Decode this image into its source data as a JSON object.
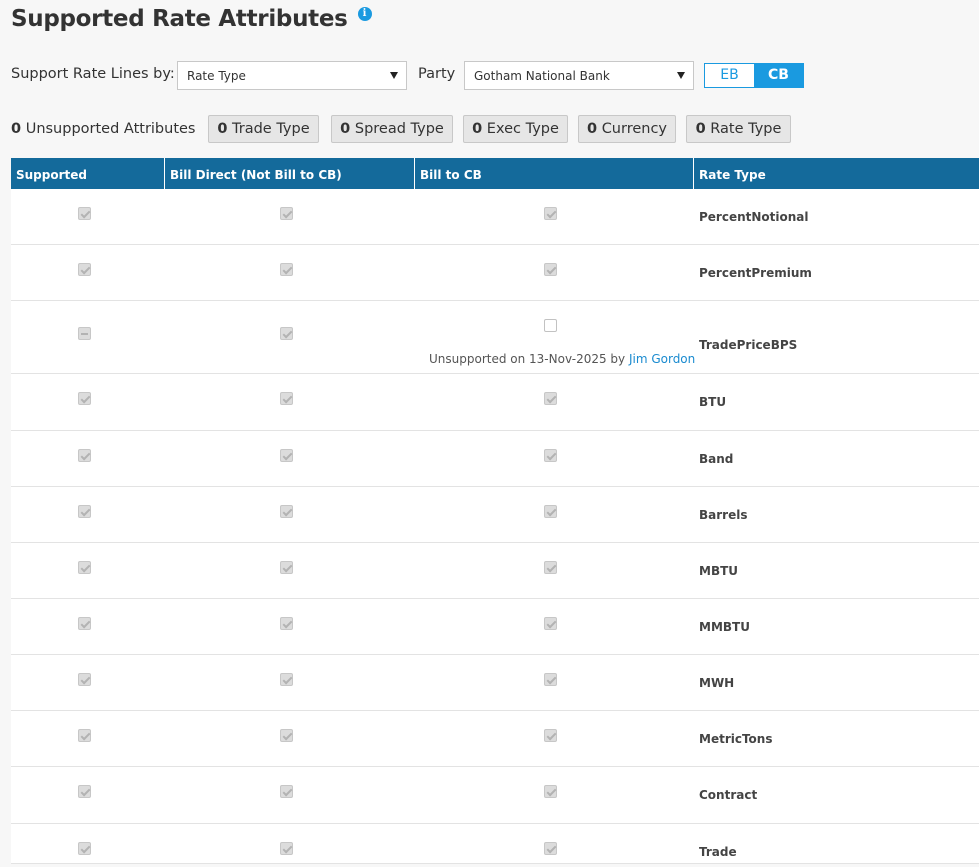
{
  "page": {
    "title": "Supported Rate Attributes",
    "info_icon": "i"
  },
  "controls": {
    "support_label": "Support Rate Lines by:",
    "support_select": "Rate Type",
    "party_label": "Party",
    "party_select": "Gotham National Bank",
    "toggle": {
      "eb": "EB",
      "cb": "CB",
      "selected": "CB"
    }
  },
  "filters": {
    "unsupported_count": "0",
    "unsupported_label": "Unsupported Attributes",
    "chips": [
      {
        "count": "0",
        "label": "Trade Type"
      },
      {
        "count": "0",
        "label": "Spread Type"
      },
      {
        "count": "0",
        "label": "Exec Type"
      },
      {
        "count": "0",
        "label": "Currency"
      },
      {
        "count": "0",
        "label": "Rate Type"
      }
    ]
  },
  "table": {
    "headers": [
      "Supported",
      "Bill Direct (Not Bill to CB)",
      "Bill to CB",
      "Rate Type"
    ],
    "rows": [
      {
        "rate_type": "PercentNotional",
        "supported": "checked",
        "bill_direct": "checked",
        "bill_to_cb": "checked"
      },
      {
        "rate_type": "PercentPremium",
        "supported": "checked",
        "bill_direct": "checked",
        "bill_to_cb": "checked"
      },
      {
        "rate_type": "TradePriceBPS",
        "supported": "indeterminate",
        "bill_direct": "checked",
        "bill_to_cb": "unchecked",
        "note_prefix": "Unsupported on 13-Nov-2025 by ",
        "note_user": "Jim Gordon"
      },
      {
        "rate_type": "BTU",
        "supported": "checked",
        "bill_direct": "checked",
        "bill_to_cb": "checked"
      },
      {
        "rate_type": "Band",
        "supported": "checked",
        "bill_direct": "checked",
        "bill_to_cb": "checked"
      },
      {
        "rate_type": "Barrels",
        "supported": "checked",
        "bill_direct": "checked",
        "bill_to_cb": "checked"
      },
      {
        "rate_type": "MBTU",
        "supported": "checked",
        "bill_direct": "checked",
        "bill_to_cb": "checked"
      },
      {
        "rate_type": "MMBTU",
        "supported": "checked",
        "bill_direct": "checked",
        "bill_to_cb": "checked"
      },
      {
        "rate_type": "MWH",
        "supported": "checked",
        "bill_direct": "checked",
        "bill_to_cb": "checked"
      },
      {
        "rate_type": "MetricTons",
        "supported": "checked",
        "bill_direct": "checked",
        "bill_to_cb": "checked"
      },
      {
        "rate_type": "Contract",
        "supported": "checked",
        "bill_direct": "checked",
        "bill_to_cb": "checked"
      },
      {
        "rate_type": "Trade",
        "supported": "checked",
        "bill_direct": "checked",
        "bill_to_cb": "checked"
      }
    ]
  },
  "colors": {
    "header_bg": "#146a9b",
    "accent": "#1a9ae0",
    "link": "#1a8bd0"
  }
}
